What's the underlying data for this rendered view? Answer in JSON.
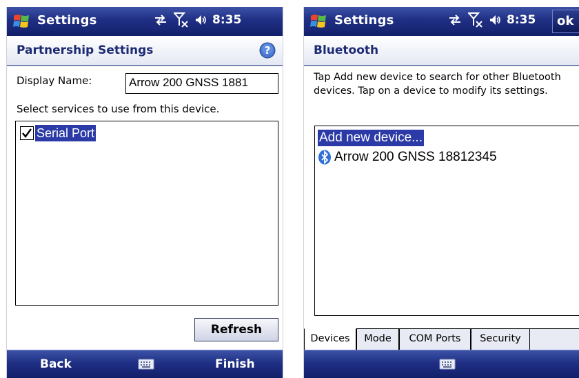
{
  "left": {
    "app_title": "Settings",
    "clock": "8:35",
    "section_title": "Partnership Settings",
    "display_name_label": "Display Name:",
    "display_name_value": "Arrow 200 GNSS 1881",
    "instruction": "Select services to use from this device.",
    "services": [
      {
        "label": "Serial Port",
        "checked": true
      }
    ],
    "refresh_label": "Refresh",
    "softkey_left": "Back",
    "softkey_right": "Finish"
  },
  "right": {
    "app_title": "Settings",
    "clock": "8:35",
    "ok_label": "ok",
    "section_title": "Bluetooth",
    "description": "Tap Add new device to search for other Bluetooth devices. Tap on a device to modify its settings.",
    "devices": [
      "Add new device...",
      "Arrow 200 GNSS 18812345"
    ],
    "tabs": [
      "Devices",
      "Mode",
      "COM Ports",
      "Security"
    ],
    "active_tab": "Devices"
  },
  "icons": {
    "start": "windows-flag-icon",
    "connectivity": "sync-arrows-icon",
    "signal": "no-signal-antenna-icon",
    "volume": "speaker-icon",
    "help": "help-icon",
    "keyboard": "keyboard-icon",
    "bluetooth": "bluetooth-icon"
  },
  "colors": {
    "titlebar": "#1f2f84",
    "selection": "#2b3aa6",
    "section_title": "#1c2a73",
    "help": "#4a78d0"
  }
}
